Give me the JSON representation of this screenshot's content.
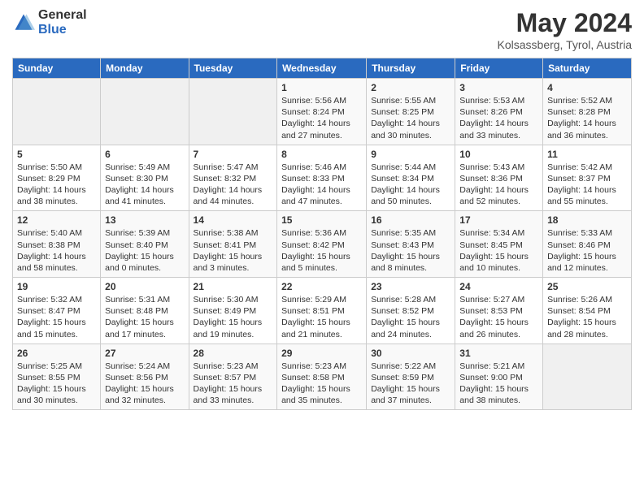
{
  "logo": {
    "general": "General",
    "blue": "Blue"
  },
  "title": "May 2024",
  "subtitle": "Kolsassberg, Tyrol, Austria",
  "headers": [
    "Sunday",
    "Monday",
    "Tuesday",
    "Wednesday",
    "Thursday",
    "Friday",
    "Saturday"
  ],
  "weeks": [
    [
      {
        "day": "",
        "info": ""
      },
      {
        "day": "",
        "info": ""
      },
      {
        "day": "",
        "info": ""
      },
      {
        "day": "1",
        "info": "Sunrise: 5:56 AM\nSunset: 8:24 PM\nDaylight: 14 hours and 27 minutes."
      },
      {
        "day": "2",
        "info": "Sunrise: 5:55 AM\nSunset: 8:25 PM\nDaylight: 14 hours and 30 minutes."
      },
      {
        "day": "3",
        "info": "Sunrise: 5:53 AM\nSunset: 8:26 PM\nDaylight: 14 hours and 33 minutes."
      },
      {
        "day": "4",
        "info": "Sunrise: 5:52 AM\nSunset: 8:28 PM\nDaylight: 14 hours and 36 minutes."
      }
    ],
    [
      {
        "day": "5",
        "info": "Sunrise: 5:50 AM\nSunset: 8:29 PM\nDaylight: 14 hours and 38 minutes."
      },
      {
        "day": "6",
        "info": "Sunrise: 5:49 AM\nSunset: 8:30 PM\nDaylight: 14 hours and 41 minutes."
      },
      {
        "day": "7",
        "info": "Sunrise: 5:47 AM\nSunset: 8:32 PM\nDaylight: 14 hours and 44 minutes."
      },
      {
        "day": "8",
        "info": "Sunrise: 5:46 AM\nSunset: 8:33 PM\nDaylight: 14 hours and 47 minutes."
      },
      {
        "day": "9",
        "info": "Sunrise: 5:44 AM\nSunset: 8:34 PM\nDaylight: 14 hours and 50 minutes."
      },
      {
        "day": "10",
        "info": "Sunrise: 5:43 AM\nSunset: 8:36 PM\nDaylight: 14 hours and 52 minutes."
      },
      {
        "day": "11",
        "info": "Sunrise: 5:42 AM\nSunset: 8:37 PM\nDaylight: 14 hours and 55 minutes."
      }
    ],
    [
      {
        "day": "12",
        "info": "Sunrise: 5:40 AM\nSunset: 8:38 PM\nDaylight: 14 hours and 58 minutes."
      },
      {
        "day": "13",
        "info": "Sunrise: 5:39 AM\nSunset: 8:40 PM\nDaylight: 15 hours and 0 minutes."
      },
      {
        "day": "14",
        "info": "Sunrise: 5:38 AM\nSunset: 8:41 PM\nDaylight: 15 hours and 3 minutes."
      },
      {
        "day": "15",
        "info": "Sunrise: 5:36 AM\nSunset: 8:42 PM\nDaylight: 15 hours and 5 minutes."
      },
      {
        "day": "16",
        "info": "Sunrise: 5:35 AM\nSunset: 8:43 PM\nDaylight: 15 hours and 8 minutes."
      },
      {
        "day": "17",
        "info": "Sunrise: 5:34 AM\nSunset: 8:45 PM\nDaylight: 15 hours and 10 minutes."
      },
      {
        "day": "18",
        "info": "Sunrise: 5:33 AM\nSunset: 8:46 PM\nDaylight: 15 hours and 12 minutes."
      }
    ],
    [
      {
        "day": "19",
        "info": "Sunrise: 5:32 AM\nSunset: 8:47 PM\nDaylight: 15 hours and 15 minutes."
      },
      {
        "day": "20",
        "info": "Sunrise: 5:31 AM\nSunset: 8:48 PM\nDaylight: 15 hours and 17 minutes."
      },
      {
        "day": "21",
        "info": "Sunrise: 5:30 AM\nSunset: 8:49 PM\nDaylight: 15 hours and 19 minutes."
      },
      {
        "day": "22",
        "info": "Sunrise: 5:29 AM\nSunset: 8:51 PM\nDaylight: 15 hours and 21 minutes."
      },
      {
        "day": "23",
        "info": "Sunrise: 5:28 AM\nSunset: 8:52 PM\nDaylight: 15 hours and 24 minutes."
      },
      {
        "day": "24",
        "info": "Sunrise: 5:27 AM\nSunset: 8:53 PM\nDaylight: 15 hours and 26 minutes."
      },
      {
        "day": "25",
        "info": "Sunrise: 5:26 AM\nSunset: 8:54 PM\nDaylight: 15 hours and 28 minutes."
      }
    ],
    [
      {
        "day": "26",
        "info": "Sunrise: 5:25 AM\nSunset: 8:55 PM\nDaylight: 15 hours and 30 minutes."
      },
      {
        "day": "27",
        "info": "Sunrise: 5:24 AM\nSunset: 8:56 PM\nDaylight: 15 hours and 32 minutes."
      },
      {
        "day": "28",
        "info": "Sunrise: 5:23 AM\nSunset: 8:57 PM\nDaylight: 15 hours and 33 minutes."
      },
      {
        "day": "29",
        "info": "Sunrise: 5:23 AM\nSunset: 8:58 PM\nDaylight: 15 hours and 35 minutes."
      },
      {
        "day": "30",
        "info": "Sunrise: 5:22 AM\nSunset: 8:59 PM\nDaylight: 15 hours and 37 minutes."
      },
      {
        "day": "31",
        "info": "Sunrise: 5:21 AM\nSunset: 9:00 PM\nDaylight: 15 hours and 38 minutes."
      },
      {
        "day": "",
        "info": ""
      }
    ]
  ]
}
